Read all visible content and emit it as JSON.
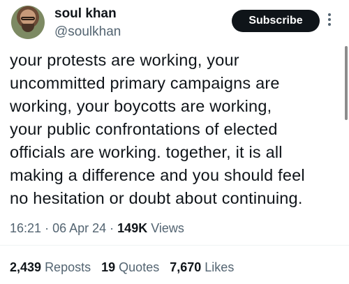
{
  "author": {
    "name": "soul khan",
    "handle": "@soulkhan"
  },
  "actions": {
    "subscribe_label": "Subscribe",
    "more_icon": "more-vertical-icon"
  },
  "tweet": {
    "text": "your protests are working, your\nuncommitted primary campaigns are\nworking, your boycotts are working,\nyour public confrontations of elected\nofficials are working. together, it is all\nmaking a difference and you should feel\nno hesitation or doubt about continuing."
  },
  "meta": {
    "time": "16:21",
    "separator": "·",
    "date": "06 Apr 24",
    "views_count": "149K",
    "views_label": "Views"
  },
  "stats": {
    "reposts_count": "2,439",
    "reposts_label": "Reposts",
    "quotes_count": "19",
    "quotes_label": "Quotes",
    "likes_count": "7,670",
    "likes_label": "Likes"
  }
}
